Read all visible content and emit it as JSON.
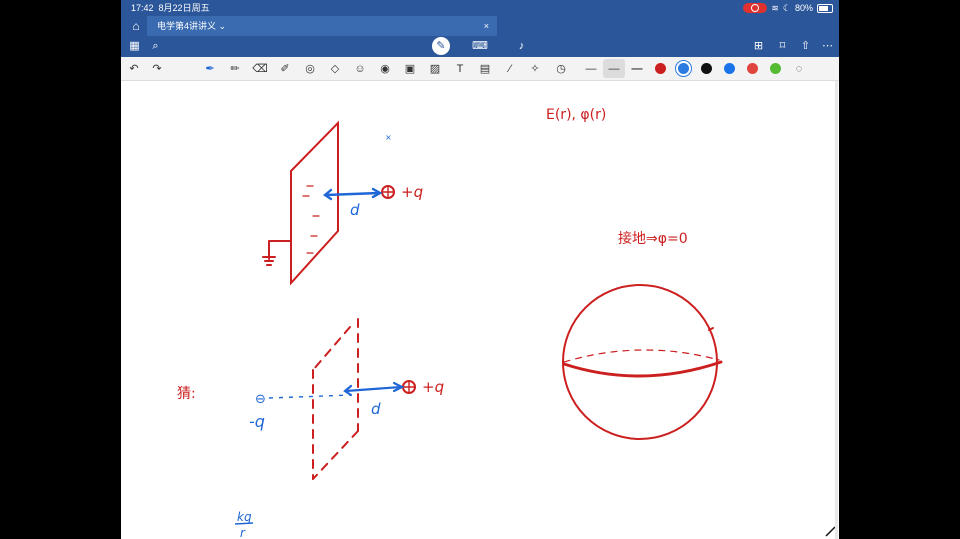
{
  "status": {
    "time": "17:42",
    "date": "8月22日周五",
    "battery": "80%"
  },
  "tab": {
    "title": "电学第4讲讲义",
    "chevron": "⌄",
    "close": "×"
  },
  "colors": {
    "ribbon": "#2b579a",
    "ink_red": "#cc1f1f",
    "ink_blue": "#1f66d6"
  },
  "toolbar2": {
    "tools": [
      "undo-icon",
      "redo-icon",
      "pen-icon",
      "pencil-icon",
      "eraser-icon",
      "highlighter-icon",
      "lasso-icon",
      "shapes-icon",
      "text-recognition-icon",
      "ruler-icon",
      "sticker-icon",
      "image-icon",
      "textbox-icon",
      "camera-icon",
      "laser-icon",
      "stroke-eraser-icon",
      "clock-icon"
    ],
    "swatches": [
      "#cc1f1f",
      "#2b7be0",
      "#111111",
      "#1a73e8",
      "#e0443e",
      "#55bb33"
    ]
  },
  "handwriting": {
    "e_field": "E(r), φ(r)",
    "grounded": "接地⇒φ=0",
    "plus_q_1": "+q",
    "plus_q_2": "+q",
    "minus_q": "-q",
    "d_1": "d",
    "d_2": "d",
    "guess": "猜:",
    "kq_num": "kq",
    "kq_den": "r"
  }
}
